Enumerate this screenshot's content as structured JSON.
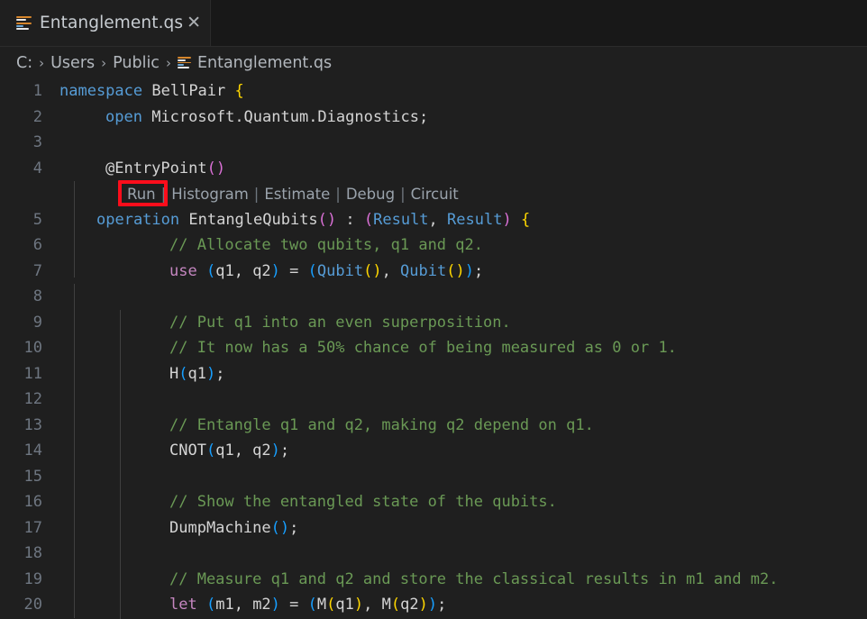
{
  "window": {
    "app": "Visual Studio Code",
    "editor_background": "#1f1f1f",
    "tabbar_background": "#181818"
  },
  "tab": {
    "icon": "qsharp-file-icon",
    "label": "Entanglement.qs",
    "close_label": "✕"
  },
  "breadcrumb": {
    "items": [
      "C:",
      "Users",
      "Public"
    ],
    "separator": "›",
    "file": "Entanglement.qs",
    "file_icon": "qsharp-file-icon"
  },
  "codelens": {
    "items": [
      "Run",
      "Histogram",
      "Estimate",
      "Debug",
      "Circuit"
    ],
    "separator": "|",
    "highlighted": "Run",
    "highlight_color": "#fc0d1b"
  },
  "editor": {
    "language": "qsharp",
    "line_numbers": [
      1,
      2,
      3,
      4,
      5,
      6,
      7,
      8,
      9,
      10,
      11,
      12,
      13,
      14,
      15,
      16,
      17,
      18,
      19,
      20
    ],
    "lines": [
      {
        "n": 1,
        "text": "namespace BellPair {"
      },
      {
        "n": 2,
        "text": "    open Microsoft.Quantum.Diagnostics;"
      },
      {
        "n": 3,
        "text": ""
      },
      {
        "n": 4,
        "text": "    @EntryPoint()"
      },
      {
        "n": 5,
        "text": "    operation EntangleQubits() : (Result, Result) {"
      },
      {
        "n": 6,
        "text": "        // Allocate two qubits, q1 and q2."
      },
      {
        "n": 7,
        "text": "        use (q1, q2) = (Qubit(), Qubit());"
      },
      {
        "n": 8,
        "text": ""
      },
      {
        "n": 9,
        "text": "        // Put q1 into an even superposition."
      },
      {
        "n": 10,
        "text": "        // It now has a 50% chance of being measured as 0 or 1."
      },
      {
        "n": 11,
        "text": "        H(q1);"
      },
      {
        "n": 12,
        "text": ""
      },
      {
        "n": 13,
        "text": "        // Entangle q1 and q2, making q2 depend on q1."
      },
      {
        "n": 14,
        "text": "        CNOT(q1, q2);"
      },
      {
        "n": 15,
        "text": ""
      },
      {
        "n": 16,
        "text": "        // Show the entangled state of the qubits."
      },
      {
        "n": 17,
        "text": "        DumpMachine();"
      },
      {
        "n": 18,
        "text": ""
      },
      {
        "n": 19,
        "text": "        // Measure q1 and q2 and store the classical results in m1 and m2."
      },
      {
        "n": 20,
        "text": "        let (m1, m2) = (M(q1), M(q2));"
      }
    ],
    "tokens": {
      "l1": [
        "namespace",
        " ",
        "BellPair",
        " ",
        "{"
      ],
      "l2": [
        "open",
        " ",
        "Microsoft.Quantum.Diagnostics;"
      ],
      "l4": [
        "@EntryPoint",
        "(",
        ")"
      ],
      "l5_a": "operation",
      "l5_b": "EntangleQubits",
      "l5_c": "()",
      "l5_d": " : ",
      "l5_e": "(",
      "l5_f": "Result",
      "l5_g": ", ",
      "l5_h": "Result",
      "l5_i": ")",
      "l5_j": " {",
      "l6": "// Allocate two qubits, q1 and q2.",
      "l7_kw": "use",
      "l7_rest": " (q1, q2) = (Qubit(), Qubit());",
      "l9": "// Put q1 into an even superposition.",
      "l10": "// It now has a 50% chance of being measured as 0 or 1.",
      "l11": "H(q1);",
      "l13": "// Entangle q1 and q2, making q2 depend on q1.",
      "l14": "CNOT(q1, q2);",
      "l16": "// Show the entangled state of the qubits.",
      "l17": "DumpMachine();",
      "l19": "// Measure q1 and q2 and store the classical results in m1 and m2.",
      "l20_kw": "let",
      "l20_rest": " (m1, m2) = (M(q1), M(q2));"
    }
  },
  "colors": {
    "keyword": "#569cd6",
    "control": "#c586c0",
    "comment": "#6a9955",
    "text": "#d4d4d4",
    "bracket1": "#ffd700",
    "bracket2": "#da70d6",
    "bracket3": "#179fff",
    "linenumber": "#6e7681",
    "annotation": "#fc0d1b"
  }
}
